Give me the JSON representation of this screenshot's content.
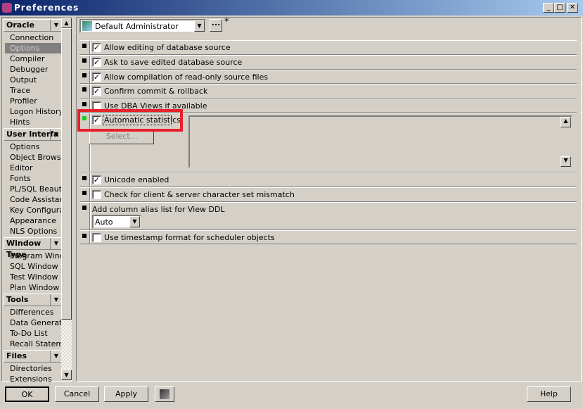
{
  "window": {
    "title": "Preferences",
    "minimize": "_",
    "maximize": "□",
    "close": "✕"
  },
  "sidebar": {
    "groups": [
      {
        "label": "Oracle",
        "items": [
          "Connection",
          "Options",
          "Compiler",
          "Debugger",
          "Output",
          "Trace",
          "Profiler",
          "Logon History",
          "Hints"
        ],
        "selected": "Options"
      },
      {
        "label": "User Interfa",
        "items": [
          "Options",
          "Object Browser",
          "Editor",
          "Fonts",
          "PL/SQL Beautifi",
          "Code Assistant",
          "Key Configurat",
          "Appearance",
          "NLS Options"
        ]
      },
      {
        "label": "Window Type",
        "items": [
          "Program Windo",
          "SQL Window",
          "Test Window",
          "Plan Window"
        ]
      },
      {
        "label": "Tools",
        "items": [
          "Differences",
          "Data Generator",
          "To-Do List",
          "Recall Statemer"
        ]
      },
      {
        "label": "Files",
        "items": [
          "Directories",
          "Extensions"
        ]
      }
    ]
  },
  "profile": {
    "value": "Default Administrator",
    "more_label": "...",
    "modified_mark": "*"
  },
  "options": [
    {
      "label": "Allow editing of database source",
      "checked": true
    },
    {
      "label": "Ask to save edited database source",
      "checked": true
    },
    {
      "label": "Allow compilation of read-only source files",
      "checked": true
    },
    {
      "label": "Confirm commit & rollback",
      "checked": true
    },
    {
      "label": "Use DBA Views if available",
      "checked": false
    },
    {
      "label": "Automatic statistics",
      "checked": true,
      "highlighted": true,
      "select_label": "Select..."
    },
    {
      "label": "Unicode enabled",
      "checked": true
    },
    {
      "label": "Check for client & server character set mismatch",
      "checked": false
    },
    {
      "label": "Add column alias list for View DDL",
      "select_value": "Auto"
    },
    {
      "label": "Use timestamp format for scheduler objects",
      "checked": false
    }
  ],
  "footer": {
    "ok": "OK",
    "cancel": "Cancel",
    "apply": "Apply",
    "help": "Help"
  },
  "colors": {
    "highlight": "#e8202a",
    "modified_marker": "#22cc22",
    "selection": "#808080"
  }
}
